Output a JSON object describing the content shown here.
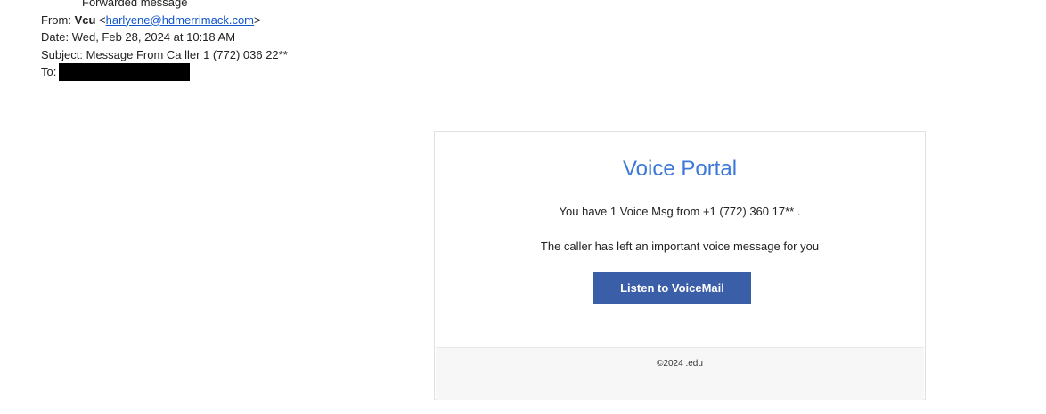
{
  "email_header": {
    "forwarded_label": "Forwarded message",
    "from_label": "From:",
    "from_name": "Vcu",
    "from_email": "harlyene@hdmerrimack.com",
    "date_label": "Date:",
    "date_value": "Wed, Feb 28, 2024 at 10:18 AM",
    "subject_label": "Subject:",
    "subject_value": "Message From Ca ller 1 (772) 036 22**",
    "to_label": "To:"
  },
  "card": {
    "title": "Voice Portal",
    "line1": "You have 1 Voice Msg from +1 (772) 360 17** .",
    "line2": "The caller has left an important voice message for you",
    "button_label": "Listen to VoiceMail",
    "footer": "©2024 .edu"
  },
  "colors": {
    "title": "#3c78d8",
    "button": "#3b5ea8",
    "link": "#1155cc",
    "footer_bg": "#f7f7f7"
  }
}
